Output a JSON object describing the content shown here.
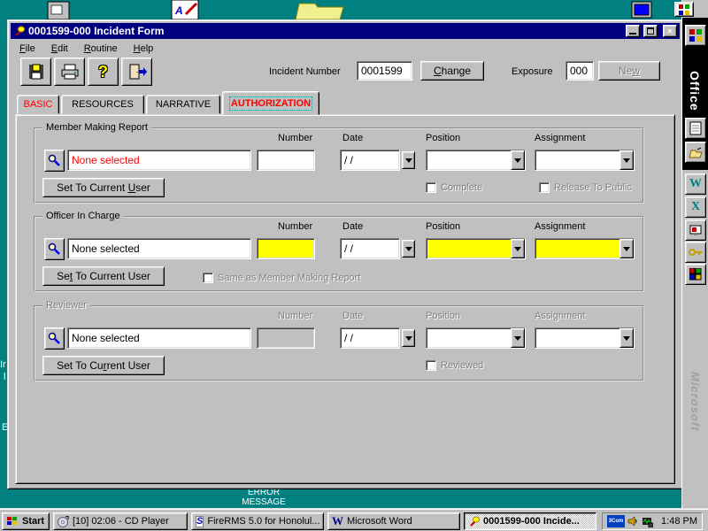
{
  "colors": {
    "desktop": "#008080",
    "titlebar": "#000080",
    "required_field": "#ffff00",
    "alert_text": "#ff0000",
    "window_face": "#c0c0c0"
  },
  "desktop": {
    "icon_label": {
      "line1": "ERROR",
      "line2": "MESSAGE"
    },
    "edge_fragments": {
      "f1": "Ir",
      "f2": "l",
      "f3": "E"
    }
  },
  "office_bar": {
    "title": "Office",
    "brand": "Microsoft"
  },
  "window": {
    "title": "0001599-000 Incident Form",
    "menu": [
      {
        "u": "F",
        "rest": "ile"
      },
      {
        "u": "E",
        "rest": "dit"
      },
      {
        "u": "R",
        "rest": "outine"
      },
      {
        "u": "H",
        "rest": "elp"
      }
    ],
    "toolbar": {
      "help_glyph": "?"
    },
    "header": {
      "incident_number_label": "Incident Number",
      "incident_number_value": "0001599",
      "change_button": {
        "pre": "",
        "u": "C",
        "post": "hange"
      },
      "exposure_label": "Exposure",
      "exposure_value": "000",
      "new_button": {
        "pre": "Ne",
        "u": "w",
        "post": ""
      }
    },
    "tabs": {
      "t0": "BASIC",
      "t1": "RESOURCES",
      "t2": "NARRATIVE",
      "t3": "AUTHORIZATION"
    },
    "active_tab": "AUTHORIZATION",
    "columns": {
      "number": "Number",
      "date": "Date",
      "position": "Position",
      "assignment": "Assignment"
    },
    "groups": [
      {
        "title": "Member Making Report",
        "selected": "None selected",
        "date_value": "/ /",
        "set_button": {
          "pre": "Set To Current ",
          "u": "U",
          "post": "ser"
        },
        "checkbox1": "Complete",
        "checkbox2": "Release To Public"
      },
      {
        "title": "Officer In Charge",
        "selected": "None selected",
        "date_value": "/ /",
        "set_button": {
          "pre": "Se",
          "u": "t",
          "post": " To Current User"
        },
        "checkbox1": "Same as Member Making Report"
      },
      {
        "title": "Reviewer",
        "selected": "None selected",
        "date_value": "/ /",
        "set_button": {
          "pre": "Set To Cu",
          "u": "r",
          "post": "rent User"
        },
        "checkbox1": "Reviewed"
      }
    ]
  },
  "taskbar": {
    "start": "Start",
    "tasks": [
      {
        "label": "[10] 02:06 - CD Player"
      },
      {
        "label": "FireRMS 5.0 for Honolul..."
      },
      {
        "label": "Microsoft Word"
      },
      {
        "label": "0001599-000 Incide..."
      }
    ],
    "tray": {
      "badge": "3Com",
      "time": "1:48 PM"
    }
  }
}
